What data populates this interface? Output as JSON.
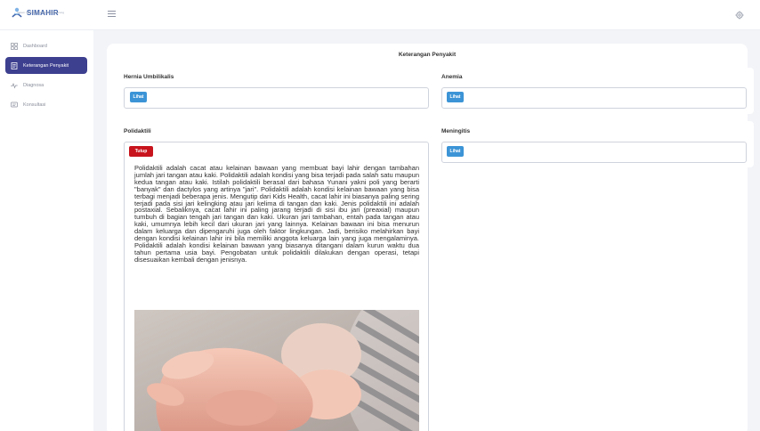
{
  "app": {
    "name": "SIMAHIR",
    "tagline": "Sistem Informasi Masalah Hirschsprung"
  },
  "sidebar": {
    "items": [
      {
        "label": "Dashboard",
        "icon": "grid-icon",
        "active": false
      },
      {
        "label": "Keterangan Penyakit",
        "icon": "document-icon",
        "active": true
      },
      {
        "label": "Diagnosa",
        "icon": "pulse-icon",
        "active": false
      },
      {
        "label": "Konsultasi",
        "icon": "chat-icon",
        "active": false
      }
    ]
  },
  "page": {
    "title": "Keterangan Penyakit"
  },
  "diseases": [
    {
      "name": "Hernia Umbilikalis",
      "button": "Lihat"
    },
    {
      "name": "Anemia",
      "button": "Lihat"
    },
    {
      "name": "Polidaktili",
      "button": "Tutup"
    },
    {
      "name": "Meningitis",
      "button": "Lihat"
    }
  ],
  "polidaktili_description": "Polidaktili adalah cacat atau kelainan bawaan yang membuat bayi lahir dengan tambahan jumlah jari tangan atau kaki. Polidaktili adalah kondisi yang bisa terjadi pada salah satu maupun kedua tangan atau kaki. Istilah polidaktili berasal dari bahasa Yunani yakni poli yang berarti \"banyak\" dan dactylos yang artinya \"jari\". Polidaktili adalah kondisi kelainan bawaan yang bisa terbagi menjadi beberapa jenis. Mengutip dari Kids Health, cacat lahir ini biasanya paling sering terjadi pada sisi jari kelingking atau jari kelima di tangan dan kaki. Jenis polidaktili ini adalah postaxial. Sebaliknya, cacat lahir ini paling jarang terjadi di sisi ibu jari (preaxial) maupun tumbuh di bagian tengah jari tangan dan kaki. Ukuran jari tambahan, entah pada tangan atau kaki, umumnya lebih kecil dari ukuran jari yang lainnya. Kelainan bawaan ini bisa menurun dalam keluarga dan dipengaruhi juga oleh faktor lingkungan. Jadi, berisiko melahirkan bayi dengan kondisi kelainan lahir ini bila memiliki anggota keluarga lain yang juga mengalaminya. Polidaktili adalah kondisi kelainan bawaan yang biasanya ditangani dalam kurun waktu dua tahun pertama usia bayi. Pengobatan untuk polidaktili dilakukan dengan operasi, tetapi disesuaikan kembali dengan jenisnya.",
  "colors": {
    "primary": "#3d3f8f",
    "info": "#3c94d6",
    "danger": "#c8141d"
  }
}
